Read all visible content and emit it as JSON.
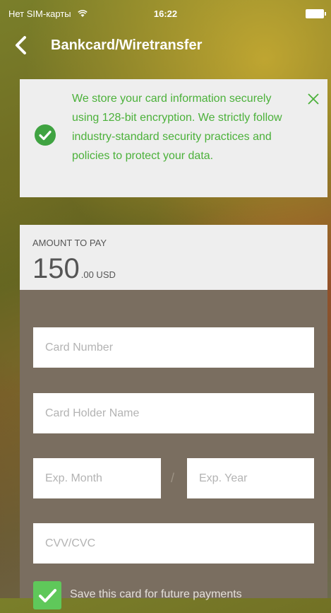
{
  "status": {
    "carrier": "Нет SIM-карты",
    "wifi_icon": "wifi-icon",
    "time": "16:22",
    "battery_icon": "battery-icon"
  },
  "nav": {
    "back_icon": "chevron-left-icon",
    "title": "Bankcard/Wiretransfer"
  },
  "notice": {
    "text": "We store your card information securely using 128-bit encryption. We strictly follow industry-standard security practices and policies to protect your data.",
    "icon": "check-circle-icon",
    "close_icon": "close-icon",
    "accent_color": "#4bb13a"
  },
  "amount": {
    "label": "AMOUNT TO PAY",
    "main": "150",
    "sub": ".00 USD"
  },
  "form": {
    "card_number_placeholder": "Card Number",
    "card_holder_placeholder": "Card Holder Name",
    "exp_month_placeholder": "Exp. Month",
    "exp_separator": "/",
    "exp_year_placeholder": "Exp. Year",
    "cvv_placeholder": "CVV/CVC",
    "save_card_label": "Save this card for future payments",
    "save_card_checked": true
  }
}
